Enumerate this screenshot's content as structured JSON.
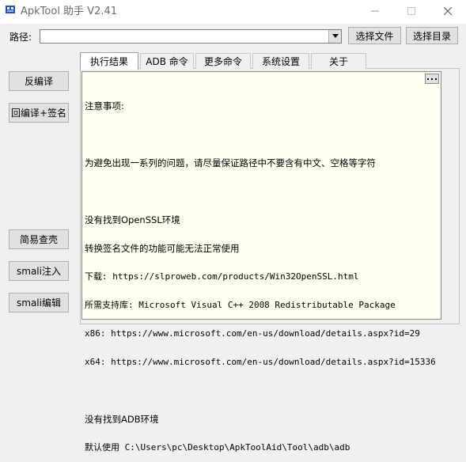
{
  "window": {
    "title": "ApkTool 助手 V2.41"
  },
  "path_row": {
    "label": "路径:",
    "value": "",
    "placeholder": "",
    "choose_file_label": "选择文件",
    "choose_dir_label": "选择目录"
  },
  "sidebar": {
    "decompile_label": "反编译",
    "recompile_sign_label": "回编译+签名",
    "easy_check_label": "简易查壳",
    "smali_inject_label": "smali注入",
    "smali_edit_label": "smali编辑"
  },
  "tabs": [
    {
      "label": "执行结果",
      "active": true
    },
    {
      "label": "ADB 命令",
      "active": false
    },
    {
      "label": "更多命令",
      "active": false
    },
    {
      "label": "系统设置",
      "active": false
    },
    {
      "label": "关于",
      "active": false
    }
  ],
  "output": {
    "lines": [
      "注意事项:",
      "",
      "为避免出现一系列的问题，请尽量保证路径中不要含有中文、空格等字符",
      "",
      "没有找到OpenSSL环境",
      "转换签名文件的功能可能无法正常使用",
      "下载: https://slproweb.com/products/Win32OpenSSL.html",
      "所需支持库: Microsoft Visual C++ 2008 Redistributable Package",
      "x86: https://www.microsoft.com/en-us/download/details.aspx?id=29",
      "x64: https://www.microsoft.com/en-us/download/details.aspx?id=15336",
      "",
      "没有找到ADB环境",
      "默认使用 C:\\Users\\pc\\Desktop\\ApkToolAid\\Tool\\adb\\adb"
    ]
  },
  "icons": {
    "app": "app-icon",
    "minimize": "minimize-icon",
    "maximize": "maximize-icon",
    "close": "close-icon",
    "dropdown": "chevron-down-icon",
    "more": "more-icon"
  }
}
